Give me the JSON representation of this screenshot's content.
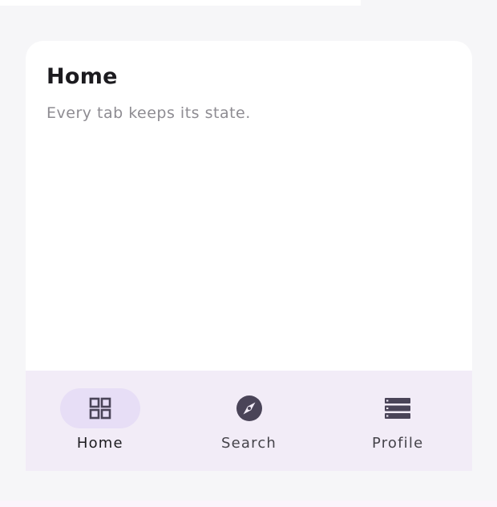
{
  "card": {
    "title": "Home",
    "subtitle": "Every tab keeps its state."
  },
  "nav": {
    "active_tab": "home",
    "items": [
      {
        "label": "Home",
        "icon": "grid-icon"
      },
      {
        "label": "Search",
        "icon": "compass-icon"
      },
      {
        "label": "Profile",
        "icon": "list-icon"
      }
    ]
  },
  "colors": {
    "background": "#f6f6f8",
    "card": "#ffffff",
    "nav_bar": "#f2ecf7",
    "active_indicator": "#e7def6",
    "icon": "#4a4458",
    "title_text": "#1c1b1f",
    "subtitle_text": "#8e8c92"
  }
}
